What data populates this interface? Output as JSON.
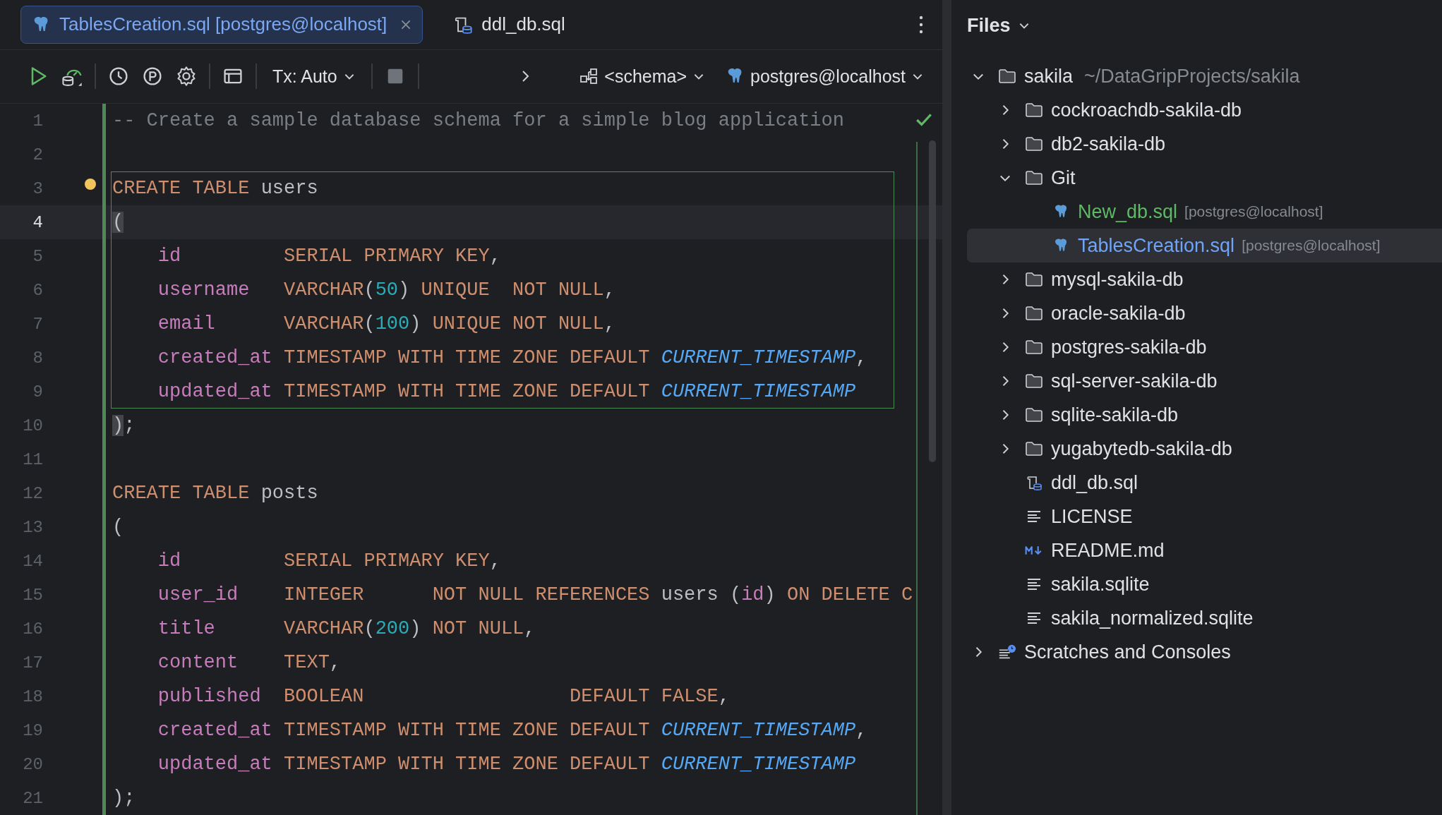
{
  "editor_tabs": [
    {
      "label": "TablesCreation.sql [postgres@localhost]",
      "kind": "pg",
      "selected": true,
      "closable": true
    },
    {
      "label": "ddl_db.sql",
      "kind": "ddl",
      "selected": false,
      "closable": false
    }
  ],
  "toolbar": {
    "transaction": "Tx: Auto",
    "schema": "<schema>",
    "datasource": "postgres@localhost"
  },
  "code": {
    "lines": [
      {
        "number": "1",
        "current": false,
        "tokens": [
          {
            "kind": "comment",
            "text": "-- Create a sample database schema for a simple blog application"
          }
        ]
      },
      {
        "number": "2",
        "current": false
      },
      {
        "number": "3",
        "current": false,
        "tokens": [
          {
            "kind": "kw",
            "text": "CREATE TABLE "
          },
          {
            "kind": "plain",
            "text": "users"
          }
        ]
      },
      {
        "number": "4",
        "current": true,
        "tokens": [
          {
            "kind": "match",
            "text": "("
          }
        ]
      },
      {
        "number": "5",
        "current": false,
        "indent": true,
        "tokens": [
          {
            "kind": "col",
            "text": "id         "
          },
          {
            "kind": "kw",
            "text": "SERIAL PRIMARY KEY"
          },
          {
            "kind": "plain",
            "text": ","
          }
        ]
      },
      {
        "number": "6",
        "current": false,
        "indent": true,
        "tokens": [
          {
            "kind": "col",
            "text": "username   "
          },
          {
            "kind": "kw",
            "text": "VARCHAR"
          },
          {
            "kind": "plain",
            "text": "("
          },
          {
            "kind": "num",
            "text": "50"
          },
          {
            "kind": "plain",
            "text": ") "
          },
          {
            "kind": "kw",
            "text": "UNIQUE  NOT NULL"
          },
          {
            "kind": "plain",
            "text": ","
          }
        ]
      },
      {
        "number": "7",
        "current": false,
        "indent": true,
        "tokens": [
          {
            "kind": "col",
            "text": "email      "
          },
          {
            "kind": "kw",
            "text": "VARCHAR"
          },
          {
            "kind": "plain",
            "text": "("
          },
          {
            "kind": "num",
            "text": "100"
          },
          {
            "kind": "plain",
            "text": ") "
          },
          {
            "kind": "kw",
            "text": "UNIQUE NOT NULL"
          },
          {
            "kind": "plain",
            "text": ","
          }
        ]
      },
      {
        "number": "8",
        "current": false,
        "indent": true,
        "tokens": [
          {
            "kind": "col",
            "text": "created_at "
          },
          {
            "kind": "kw",
            "text": "TIMESTAMP WITH TIME ZONE DEFAULT "
          },
          {
            "kind": "func",
            "text": "CURRENT_TIMESTAMP"
          },
          {
            "kind": "plain",
            "text": ","
          }
        ]
      },
      {
        "number": "9",
        "current": false,
        "indent": true,
        "tokens": [
          {
            "kind": "col",
            "text": "updated_at "
          },
          {
            "kind": "kw",
            "text": "TIMESTAMP WITH TIME ZONE DEFAULT "
          },
          {
            "kind": "func",
            "text": "CURRENT_TIMESTAMP"
          }
        ]
      },
      {
        "number": "10",
        "current": false,
        "tokens": [
          {
            "kind": "match",
            "text": ")"
          },
          {
            "kind": "plain",
            "text": ";"
          }
        ]
      },
      {
        "number": "11",
        "current": false
      },
      {
        "number": "12",
        "current": false,
        "tokens": [
          {
            "kind": "kw",
            "text": "CREATE TABLE "
          },
          {
            "kind": "plain",
            "text": "posts"
          }
        ]
      },
      {
        "number": "13",
        "current": false,
        "tokens": [
          {
            "kind": "plain",
            "text": "("
          }
        ]
      },
      {
        "number": "14",
        "current": false,
        "indent": true,
        "tokens": [
          {
            "kind": "col",
            "text": "id         "
          },
          {
            "kind": "kw",
            "text": "SERIAL PRIMARY KEY"
          },
          {
            "kind": "plain",
            "text": ","
          }
        ]
      },
      {
        "number": "15",
        "current": false,
        "indent": true,
        "tokens": [
          {
            "kind": "col",
            "text": "user_id    "
          },
          {
            "kind": "kw",
            "text": "INTEGER      NOT NULL REFERENCES "
          },
          {
            "kind": "plain",
            "text": "users ("
          },
          {
            "kind": "col",
            "text": "id"
          },
          {
            "kind": "plain",
            "text": ") "
          },
          {
            "kind": "kw",
            "text": "ON DELETE C"
          }
        ]
      },
      {
        "number": "16",
        "current": false,
        "indent": true,
        "tokens": [
          {
            "kind": "col",
            "text": "title      "
          },
          {
            "kind": "kw",
            "text": "VARCHAR"
          },
          {
            "kind": "plain",
            "text": "("
          },
          {
            "kind": "num",
            "text": "200"
          },
          {
            "kind": "plain",
            "text": ") "
          },
          {
            "kind": "kw",
            "text": "NOT NULL"
          },
          {
            "kind": "plain",
            "text": ","
          }
        ]
      },
      {
        "number": "17",
        "current": false,
        "indent": true,
        "tokens": [
          {
            "kind": "col",
            "text": "content    "
          },
          {
            "kind": "kw",
            "text": "TEXT"
          },
          {
            "kind": "plain",
            "text": ","
          }
        ]
      },
      {
        "number": "18",
        "current": false,
        "indent": true,
        "tokens": [
          {
            "kind": "col",
            "text": "published  "
          },
          {
            "kind": "kw",
            "text": "BOOLEAN                  DEFAULT FALSE"
          },
          {
            "kind": "plain",
            "text": ","
          }
        ]
      },
      {
        "number": "19",
        "current": false,
        "indent": true,
        "tokens": [
          {
            "kind": "col",
            "text": "created_at "
          },
          {
            "kind": "kw",
            "text": "TIMESTAMP WITH TIME ZONE DEFAULT "
          },
          {
            "kind": "func",
            "text": "CURRENT_TIMESTAMP"
          },
          {
            "kind": "plain",
            "text": ","
          }
        ]
      },
      {
        "number": "20",
        "current": false,
        "indent": true,
        "tokens": [
          {
            "kind": "col",
            "text": "updated_at "
          },
          {
            "kind": "kw",
            "text": "TIMESTAMP WITH TIME ZONE DEFAULT "
          },
          {
            "kind": "func",
            "text": "CURRENT_TIMESTAMP"
          }
        ]
      },
      {
        "number": "21",
        "current": false,
        "tokens": [
          {
            "kind": "plain",
            "text": ");"
          }
        ]
      }
    ]
  },
  "files_panel": {
    "title": "Files",
    "tree": [
      {
        "label": "sakila",
        "path": "~/DataGripProjects/sakila",
        "kind": "folder",
        "expanded": true,
        "selected": false,
        "children": [
          {
            "label": "cockroachdb-sakila-db",
            "kind": "folder",
            "expanded": false,
            "selected": false
          },
          {
            "label": "db2-sakila-db",
            "kind": "folder",
            "expanded": false,
            "selected": false
          },
          {
            "label": "Git",
            "kind": "folder",
            "expanded": true,
            "selected": false,
            "children": [
              {
                "label": "New_db.sql",
                "hint": "[postgres@localhost]",
                "kind": "pg",
                "selected": false,
                "color": "#5fb865"
              },
              {
                "label": "TablesCreation.sql",
                "hint": "[postgres@localhost]",
                "kind": "pg",
                "selected": true,
                "color": "#6fa4f7"
              }
            ]
          },
          {
            "label": "mysql-sakila-db",
            "kind": "folder",
            "expanded": false,
            "selected": false
          },
          {
            "label": "oracle-sakila-db",
            "kind": "folder",
            "expanded": false,
            "selected": false
          },
          {
            "label": "postgres-sakila-db",
            "kind": "folder",
            "expanded": false,
            "selected": false
          },
          {
            "label": "sql-server-sakila-db",
            "kind": "folder",
            "expanded": false,
            "selected": false
          },
          {
            "label": "sqlite-sakila-db",
            "kind": "folder",
            "expanded": false,
            "selected": false
          },
          {
            "label": "yugabytedb-sakila-db",
            "kind": "folder",
            "expanded": false,
            "selected": false
          },
          {
            "label": "ddl_db.sql",
            "kind": "ddl",
            "selected": false
          },
          {
            "label": "LICENSE",
            "kind": "text",
            "selected": false
          },
          {
            "label": "README.md",
            "kind": "md",
            "selected": false
          },
          {
            "label": "sakila.sqlite",
            "kind": "text",
            "selected": false
          },
          {
            "label": "sakila_normalized.sqlite",
            "kind": "text",
            "selected": false
          }
        ]
      },
      {
        "label": "Scratches and Consoles",
        "kind": "scratch",
        "expanded": false,
        "selected": false
      }
    ]
  }
}
